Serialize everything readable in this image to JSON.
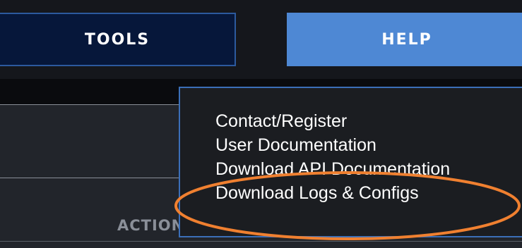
{
  "tabs": {
    "tools_label": "TOOLS",
    "help_label": "HELP"
  },
  "help_menu": {
    "items": [
      "Contact/Register",
      "User Documentation",
      "Download API Documentation",
      "Download Logs & Configs"
    ]
  },
  "panel": {
    "action_label": "ACTION"
  },
  "colors": {
    "accent": "#4e88d4",
    "tools_background": "#06173a",
    "highlight_ellipse": "#f08030"
  }
}
